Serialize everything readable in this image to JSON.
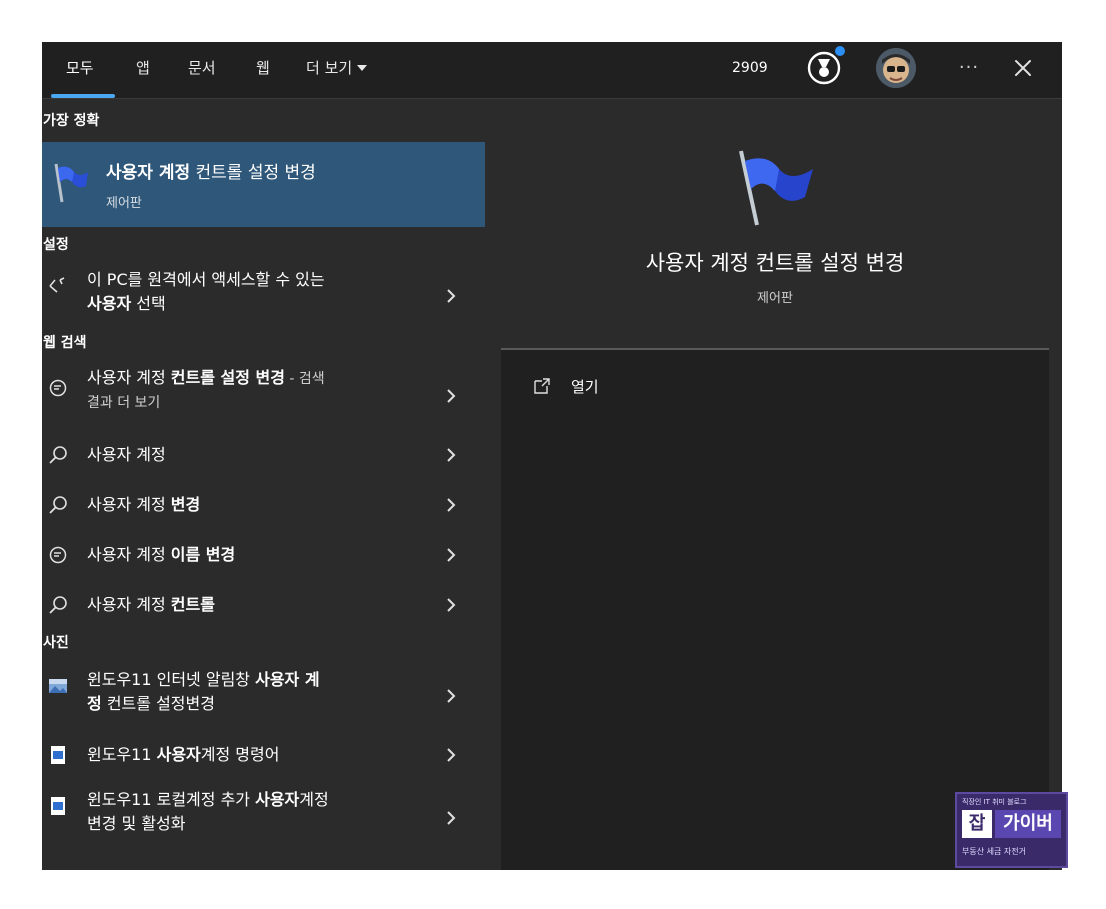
{
  "header": {
    "tabs": [
      {
        "label": "모두"
      },
      {
        "label": "앱"
      },
      {
        "label": "문서"
      },
      {
        "label": "웹"
      },
      {
        "label": "더 보기"
      }
    ],
    "points": "2909",
    "more_label": "···",
    "accent_color": "#4aa8f0"
  },
  "left": {
    "sections": {
      "best": "가장 정확",
      "settings": "설정",
      "web": "웹 검색",
      "photos": "사진"
    },
    "best": {
      "title_bold": "사용자 계정",
      "title_rest": " 컨트롤 설정 변경",
      "subtitle": "제어판",
      "icon": "uac-flag-icon",
      "highlight_color": "#2e5779"
    },
    "settings_items": [
      {
        "line1": "이 PC를 원격에서 액세스할 수 있는",
        "line2_bold": "사용자",
        "line2_rest": " 선택",
        "icon": "remote-access-icon"
      }
    ],
    "web_items": [
      {
        "pre": "사용자 계정 ",
        "bold": "컨트롤 설정 변경",
        "post": " - 검색",
        "sub": "결과 더 보기",
        "icon": "bing-search-icon"
      },
      {
        "pre": "사용자 계정",
        "bold": "",
        "icon": "search-icon"
      },
      {
        "pre": "사용자 계정 ",
        "bold": "변경",
        "icon": "search-icon"
      },
      {
        "pre": "사용자 계정 ",
        "bold": "이름 변경",
        "icon": "bing-search-icon"
      },
      {
        "pre": "사용자 계정 ",
        "bold": "컨트롤",
        "icon": "search-icon"
      }
    ],
    "photo_items": [
      {
        "line1_pre": "윈도우11 인터넷 알림창 ",
        "line1_bold": "사용자 계",
        "line2_bold": "정",
        "line2_rest": " 컨트롤 설정변경",
        "icon": "image-file-icon"
      },
      {
        "pre": "윈도우11 ",
        "bold": "사용자",
        "post": "계정 명령어",
        "icon": "document-file-icon"
      },
      {
        "line1_pre": "윈도우11 로컬계정 추가 ",
        "line1_bold": "사용자",
        "line1_post": "계정",
        "line2_rest": "변경 및 활성화",
        "icon": "document-file-icon"
      }
    ]
  },
  "detail": {
    "title": "사용자 계정 컨트롤 설정 변경",
    "subtitle": "제어판",
    "open_label": "열기"
  },
  "watermark": {
    "top": "직장인 IT 취미 블로그",
    "badge": "잡",
    "main": "가이버",
    "bottom": "부동산 세금 자전거"
  }
}
